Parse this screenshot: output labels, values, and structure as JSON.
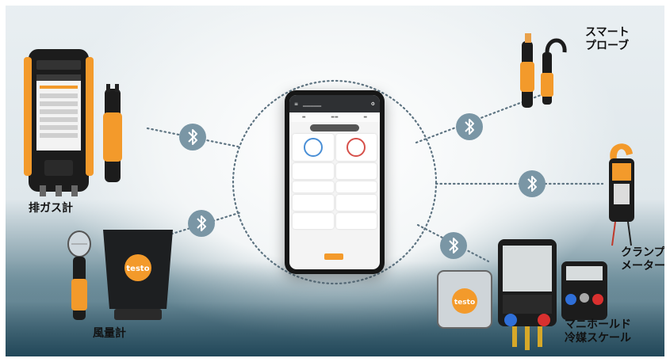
{
  "labels": {
    "flue_gas": "排ガス計",
    "air_flow": "風量計",
    "smart_probe": "スマート\nプローブ",
    "clamp_meter": "クランプ\nメーター",
    "manifold_scale": "マニホールド\n冷媒スケール"
  },
  "phone": {
    "brand_logo": "testo"
  },
  "colors": {
    "accent_orange": "#f39a2b",
    "bluetooth_badge": "#7a96a5",
    "device_black": "#1c1c1c",
    "background_dark": "#24495a"
  },
  "icons": [
    "bluetooth-icon"
  ]
}
